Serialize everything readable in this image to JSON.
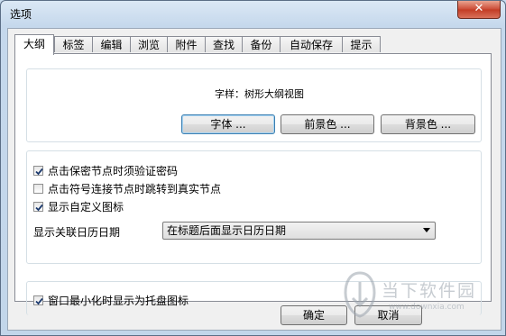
{
  "window": {
    "title": "选项",
    "close_label": "✕"
  },
  "tabs": [
    "大纲",
    "标签",
    "编辑",
    "浏览",
    "附件",
    "查找",
    "备份",
    "自动保存",
    "提示"
  ],
  "active_tab": 0,
  "font_group": {
    "sample_label": "字样：",
    "sample_text": "树形大纲视图",
    "font_button": "字体 ...",
    "foreground_button": "前景色 ...",
    "background_button": "背景色 ..."
  },
  "options_group": {
    "checkboxes": [
      {
        "label": "点击保密节点时须验证密码",
        "checked": true
      },
      {
        "label": "点击符号连接节点时跳转到真实节点",
        "checked": false
      },
      {
        "label": "显示自定义图标",
        "checked": true
      }
    ],
    "calendar_label": "显示关联日历日期",
    "calendar_value": "在标题后面显示日历日期"
  },
  "tray_group": {
    "minimize_to_tray": {
      "label": "窗口最小化时显示为托盘图标",
      "checked": true
    }
  },
  "footer": {
    "ok_button": "确定",
    "cancel_button": "取消"
  },
  "watermark": {
    "text": "当下软件园",
    "url": "www.downxia.com"
  }
}
